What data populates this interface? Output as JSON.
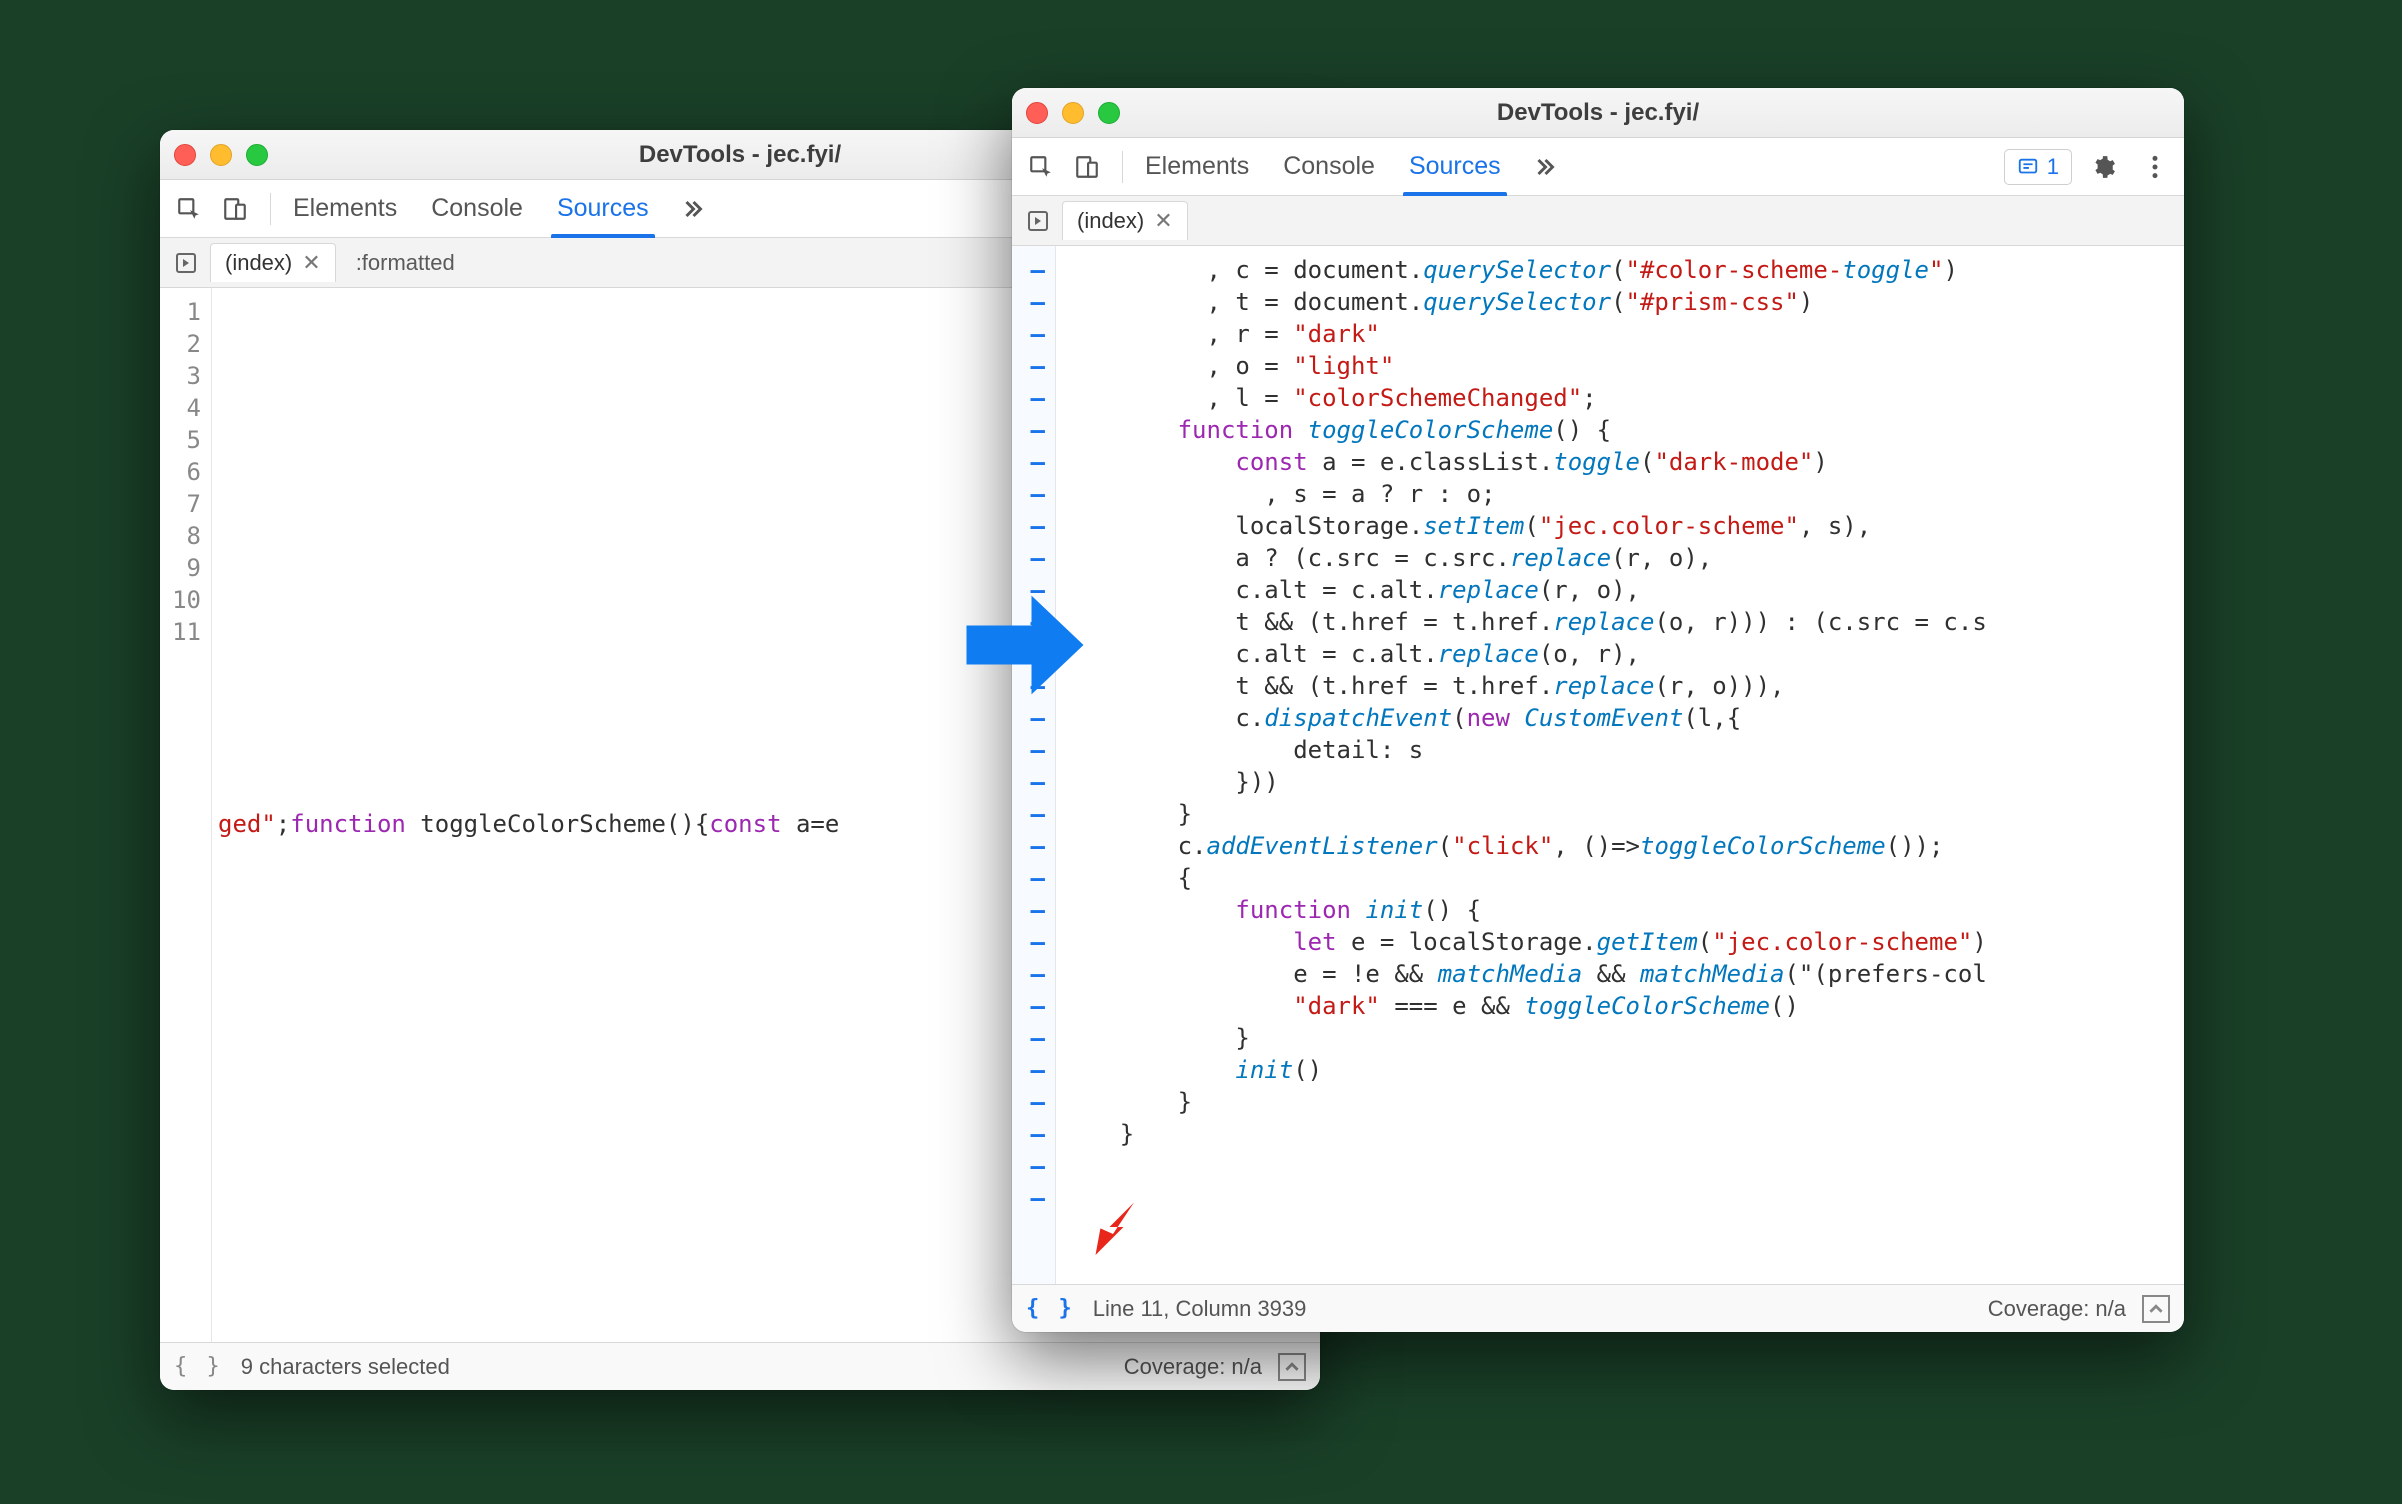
{
  "left": {
    "title": "DevTools - jec.fyi/",
    "tabs": {
      "elements": "Elements",
      "console": "Console",
      "sources": "Sources"
    },
    "file_tab": "(index)",
    "ghost_tab": ":formatted",
    "gutter": [
      "1",
      "2",
      "3",
      "4",
      "5",
      "6",
      "7",
      "8",
      "9",
      "10",
      "11"
    ],
    "line11_a": "ged\"",
    "line11_b": ";",
    "line11_c": "function",
    "line11_d": " toggleColorScheme(){",
    "line11_e": "const",
    "line11_f": " a=e",
    "status_msg": "9 characters selected",
    "coverage": "Coverage: n/a"
  },
  "right": {
    "title": "DevTools - jec.fyi/",
    "tabs": {
      "elements": "Elements",
      "console": "Console",
      "sources": "Sources"
    },
    "issues_count": "1",
    "file_tab": "(index)",
    "status_msg": "Line 11, Column 3939",
    "coverage": "Coverage: n/a",
    "code": {
      "l1": "          , c = document.querySelector(\"#color-scheme-toggle\")",
      "l2": "          , t = document.querySelector(\"#prism-css\")",
      "l3": "          , r = \"dark\"",
      "l4": "          , o = \"light\"",
      "l5": "          , l = \"colorSchemeChanged\";",
      "l6": "        function toggleColorScheme() {",
      "l7": "            const a = e.classList.toggle(\"dark-mode\")",
      "l8": "              , s = a ? r : o;",
      "l9": "            localStorage.setItem(\"jec.color-scheme\", s),",
      "l10": "            a ? (c.src = c.src.replace(r, o),",
      "l11": "            c.alt = c.alt.replace(r, o),",
      "l12": "            t && (t.href = t.href.replace(o, r))) : (c.src = c.s",
      "l13": "            c.alt = c.alt.replace(o, r),",
      "l14": "            t && (t.href = t.href.replace(r, o))),",
      "l15": "            c.dispatchEvent(new CustomEvent(l,{",
      "l16": "                detail: s",
      "l17": "            }))",
      "l18": "        }",
      "l19": "        c.addEventListener(\"click\", ()=>toggleColorScheme());",
      "l20": "        {",
      "l21": "            function init() {",
      "l22": "                let e = localStorage.getItem(\"jec.color-scheme\")",
      "l23": "                e = !e && matchMedia && matchMedia(\"(prefers-col",
      "l24": "                \"dark\" === e && toggleColorScheme()",
      "l25": "            }",
      "l26": "            init()",
      "l27": "        }",
      "l28": "    }"
    }
  }
}
